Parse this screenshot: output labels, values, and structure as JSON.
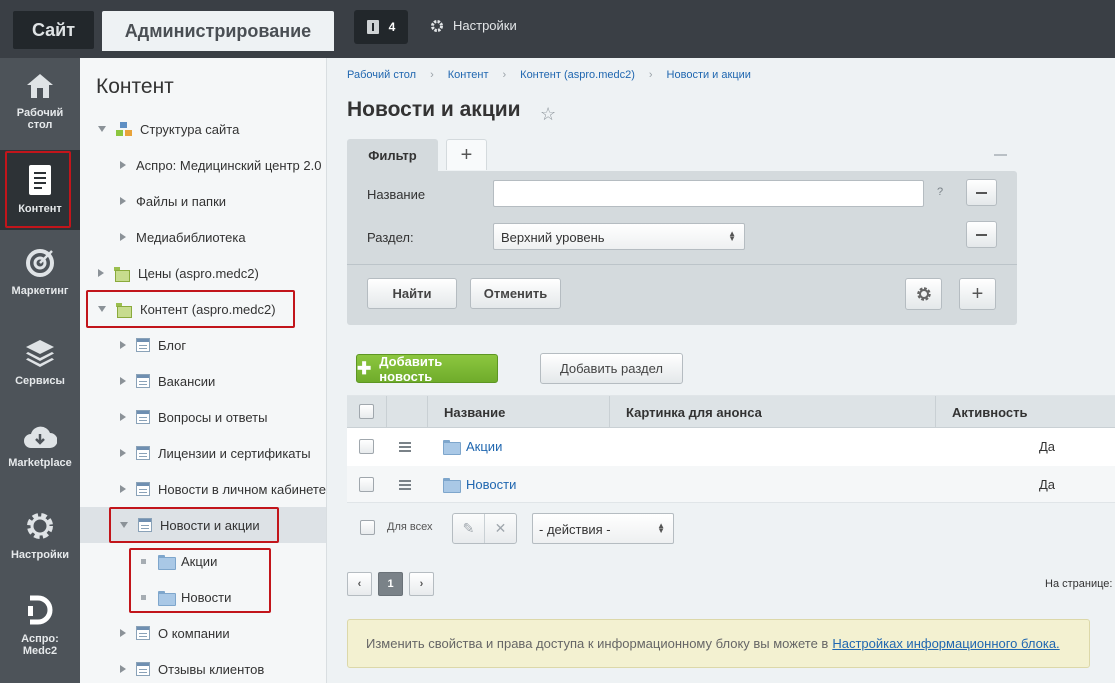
{
  "topbar": {
    "site_tab": "Сайт",
    "admin_tab": "Администрирование",
    "notifications_count": "4",
    "settings_label": "Настройки"
  },
  "leftmenu": {
    "items": [
      {
        "label_line1": "Рабочий",
        "label_line2": "стол",
        "icon": "home-icon"
      },
      {
        "label_line1": "Контент",
        "label_line2": "",
        "icon": "document-icon"
      },
      {
        "label_line1": "Маркетинг",
        "label_line2": "",
        "icon": "target-icon"
      },
      {
        "label_line1": "Сервисы",
        "label_line2": "",
        "icon": "layers-icon"
      },
      {
        "label_line1": "Marketplace",
        "label_line2": "",
        "icon": "cloud-download-icon"
      },
      {
        "label_line1": "Настройки",
        "label_line2": "",
        "icon": "gear-icon"
      },
      {
        "label_line1": "Аспро:",
        "label_line2": "Medc2",
        "icon": "aspro-logo-icon"
      }
    ]
  },
  "tree": {
    "title": "Контент",
    "nodes": [
      {
        "label": "Структура сайта"
      },
      {
        "label": "Аспро: Медицинский центр 2.0"
      },
      {
        "label": "Файлы и папки"
      },
      {
        "label": "Медиабиблиотека"
      },
      {
        "label": "Цены (aspro.medc2)"
      },
      {
        "label": "Контент (aspro.medc2)"
      },
      {
        "label": "Блог"
      },
      {
        "label": "Вакансии"
      },
      {
        "label": "Вопросы и ответы"
      },
      {
        "label": "Лицензии и сертификаты"
      },
      {
        "label": "Новости в личном кабинете"
      },
      {
        "label": "Новости и акции"
      },
      {
        "label": "Акции"
      },
      {
        "label": "Новости"
      },
      {
        "label": "О компании"
      },
      {
        "label": "Отзывы клиентов"
      }
    ]
  },
  "breadcrumb": [
    "Рабочий стол",
    "Контент",
    "Контент (aspro.medc2)",
    "Новости и акции"
  ],
  "page": {
    "title": "Новости и акции"
  },
  "filter": {
    "tab_label": "Фильтр",
    "add_tab": "+",
    "name_label": "Название",
    "name_value": "",
    "help_mark": "?",
    "section_label": "Раздел:",
    "section_value": "Верхний уровень",
    "find_button": "Найти",
    "cancel_button": "Отменить",
    "plus": "+"
  },
  "list": {
    "add_news_button": "Добавить новость",
    "add_section_button": "Добавить раздел",
    "columns": [
      "Название",
      "Картинка для анонса",
      "Активность"
    ],
    "rows": [
      {
        "name": "Акции",
        "active": "Да"
      },
      {
        "name": "Новости",
        "active": "Да"
      }
    ],
    "for_all_label": "Для всех",
    "actions_value": "- действия -"
  },
  "pager": {
    "prev": "‹",
    "current": "1",
    "next": "›",
    "per_page_label": "На странице:"
  },
  "info": {
    "text": "Изменить свойства и права доступа к информационному блоку вы можете в",
    "link": "Настройках информационного блока."
  },
  "colors": {
    "accent_red": "#c2151b",
    "green_button": "#7ab833",
    "link": "#2067b0",
    "topbar": "#3a3f45",
    "leftmenu": "#4d5359"
  }
}
